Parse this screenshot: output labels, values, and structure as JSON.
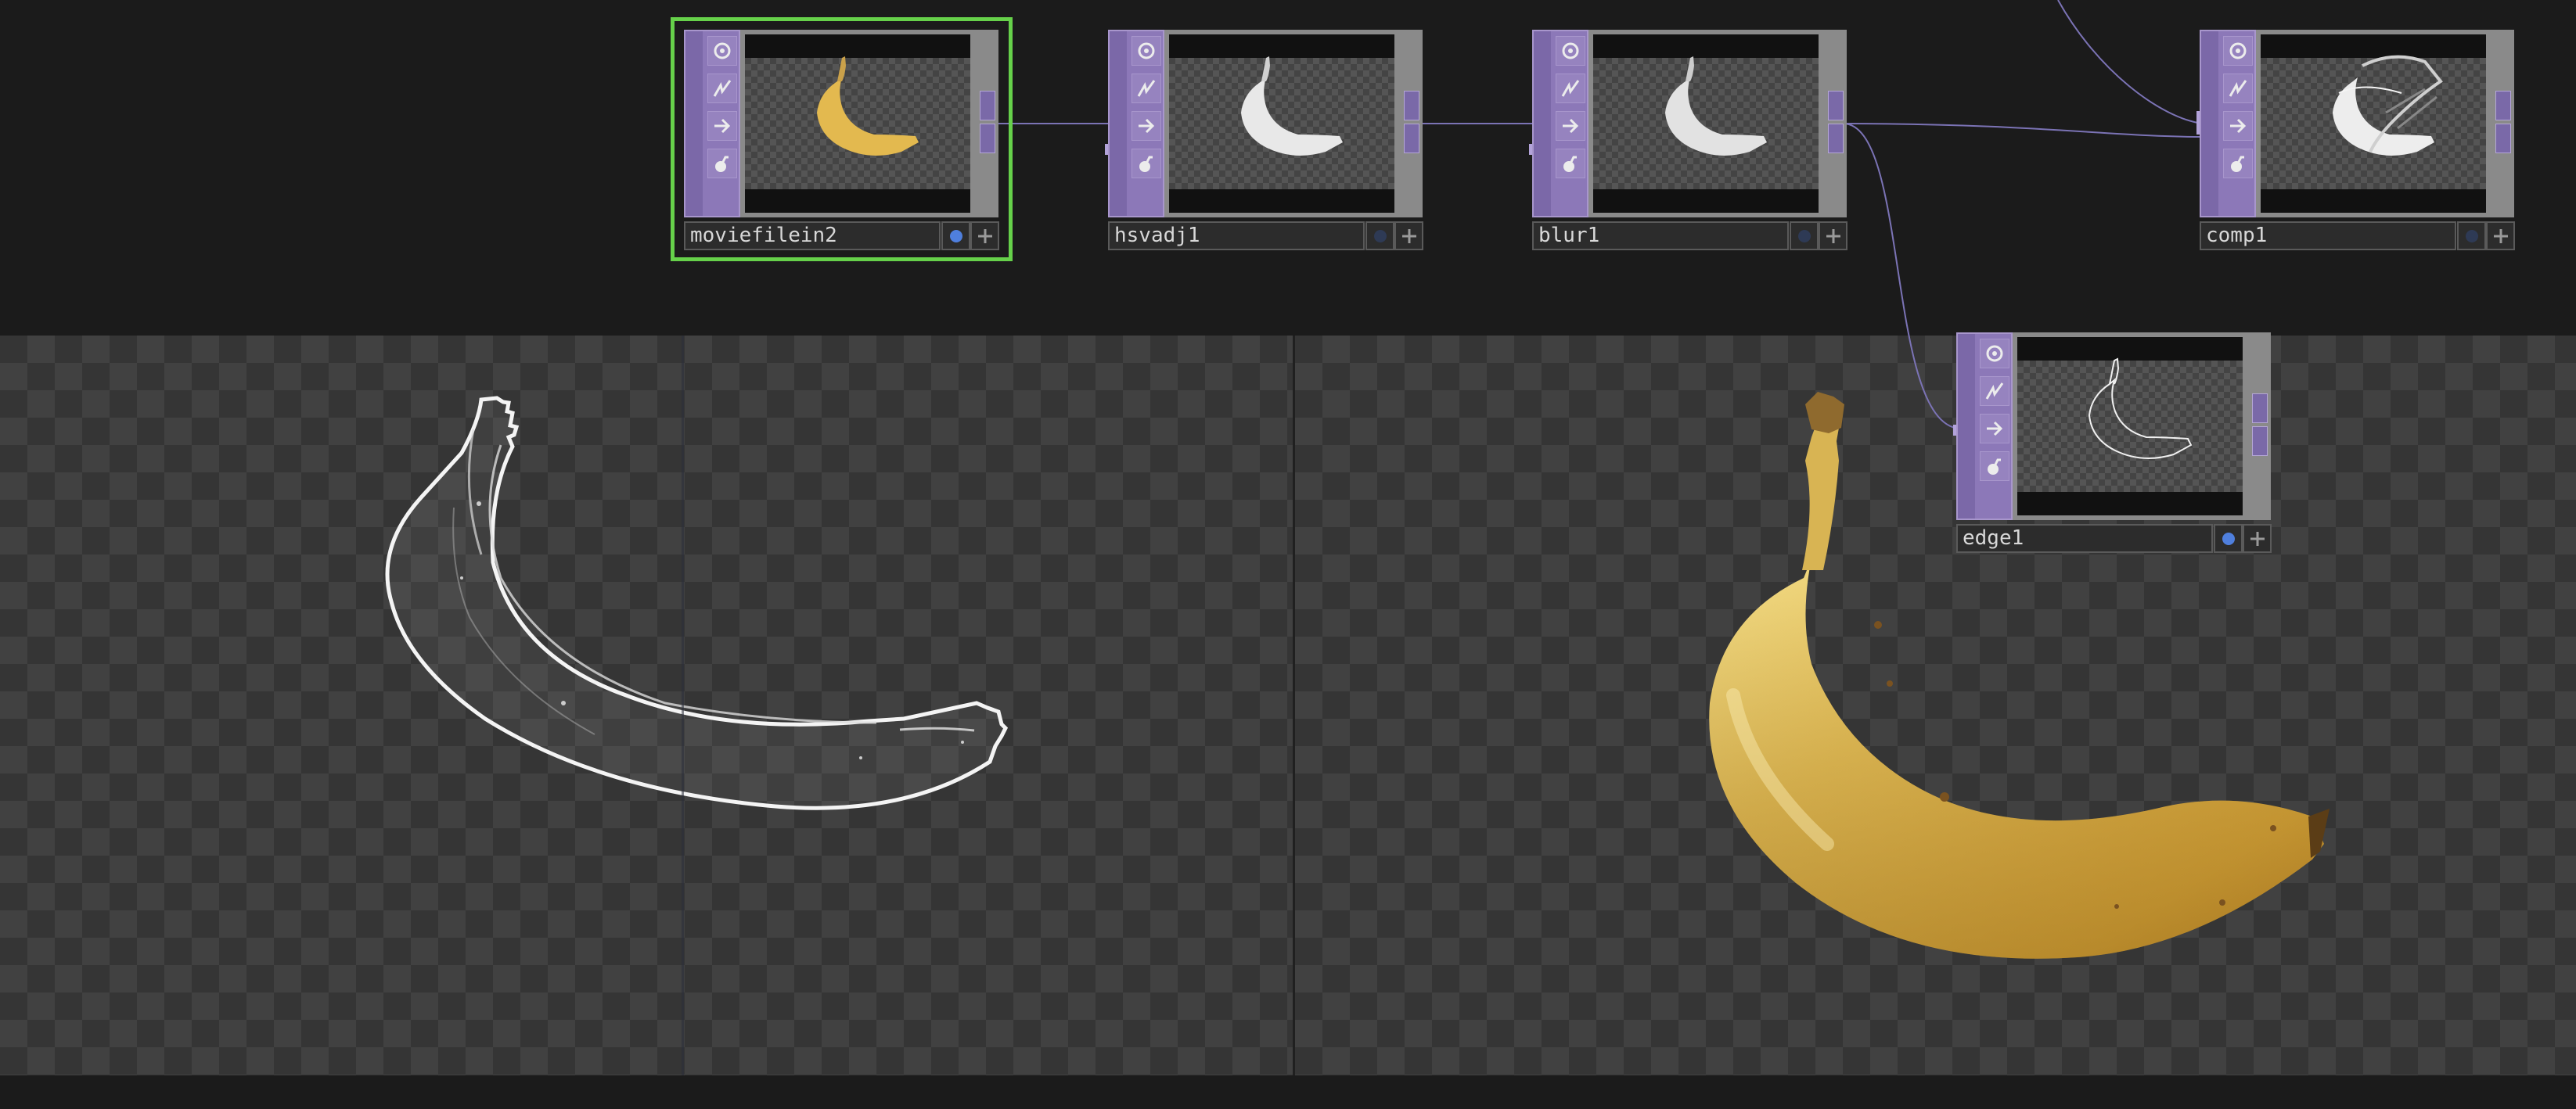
{
  "app": "TouchDesigner network editor",
  "colors": {
    "node_purple": "#8c78b8",
    "selected_outline": "#66d14a",
    "display_flag_on": "#4f7fdd",
    "banana_yellow": "#e7c25a",
    "edge_white": "#ffffff"
  },
  "network": {
    "nodes": [
      {
        "name": "moviefilein2",
        "type": "Movie File In TOP",
        "thumbnail": "color-banana",
        "display_flag": true,
        "selected": true
      },
      {
        "name": "hsvadj1",
        "type": "HSV Adjust TOP",
        "thumbnail": "gray-banana",
        "display_flag": false,
        "selected": false
      },
      {
        "name": "blur1",
        "type": "Blur TOP",
        "thumbnail": "gray-banana",
        "display_flag": false,
        "selected": false
      },
      {
        "name": "comp1",
        "type": "Composite TOP",
        "thumbnail": "comp-banana",
        "display_flag": false,
        "selected": false
      },
      {
        "name": "edge1",
        "type": "Edge TOP",
        "thumbnail": "edge-banana",
        "display_flag": true,
        "selected": false
      }
    ],
    "connections": [
      [
        "moviefilein2",
        "hsvadj1"
      ],
      [
        "hsvadj1",
        "blur1"
      ],
      [
        "blur1",
        "comp1"
      ],
      [
        "blur1",
        "edge1"
      ]
    ]
  },
  "node_flags": [
    "bypass-icon",
    "lock-graph-icon",
    "arrow-right-icon",
    "lock-icon"
  ],
  "viewers": [
    {
      "id": "left",
      "content": "edge outline of banana (edge1 output)"
    },
    {
      "id": "right",
      "content": "full color banana (moviefilein2 output)"
    }
  ]
}
